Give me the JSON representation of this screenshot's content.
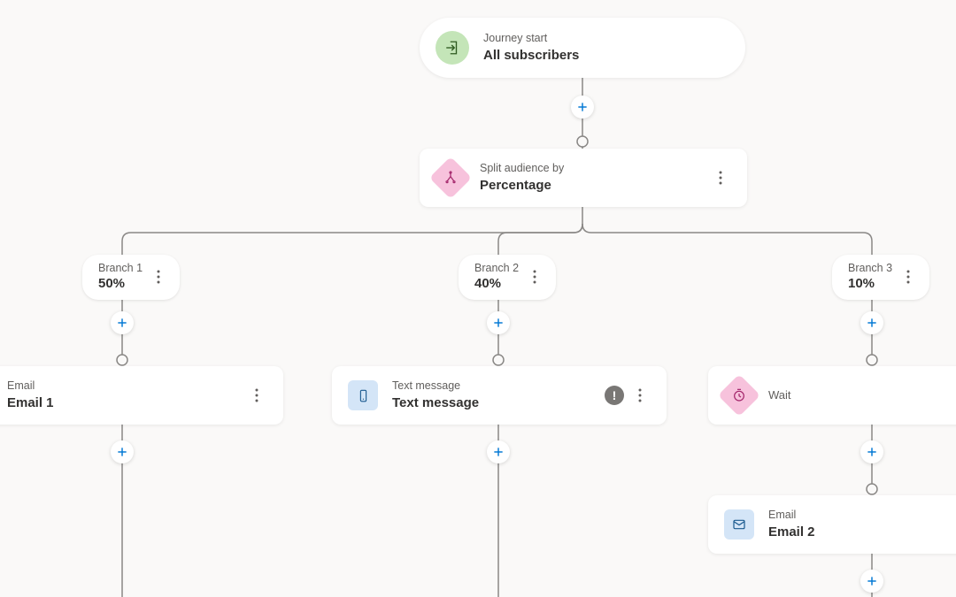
{
  "start": {
    "label": "Journey start",
    "value": "All subscribers"
  },
  "split": {
    "label": "Split audience by",
    "value": "Percentage"
  },
  "branches": {
    "b1": {
      "label": "Branch 1",
      "value": "50%"
    },
    "b2": {
      "label": "Branch 2",
      "value": "40%"
    },
    "b3": {
      "label": "Branch 3",
      "value": "10%"
    }
  },
  "nodes": {
    "email1": {
      "label": "Email",
      "value": "Email 1"
    },
    "text": {
      "label": "Text message",
      "value": "Text message"
    },
    "wait": {
      "label": "Wait",
      "value": ""
    },
    "email2": {
      "label": "Email",
      "value": "Email 2"
    }
  }
}
